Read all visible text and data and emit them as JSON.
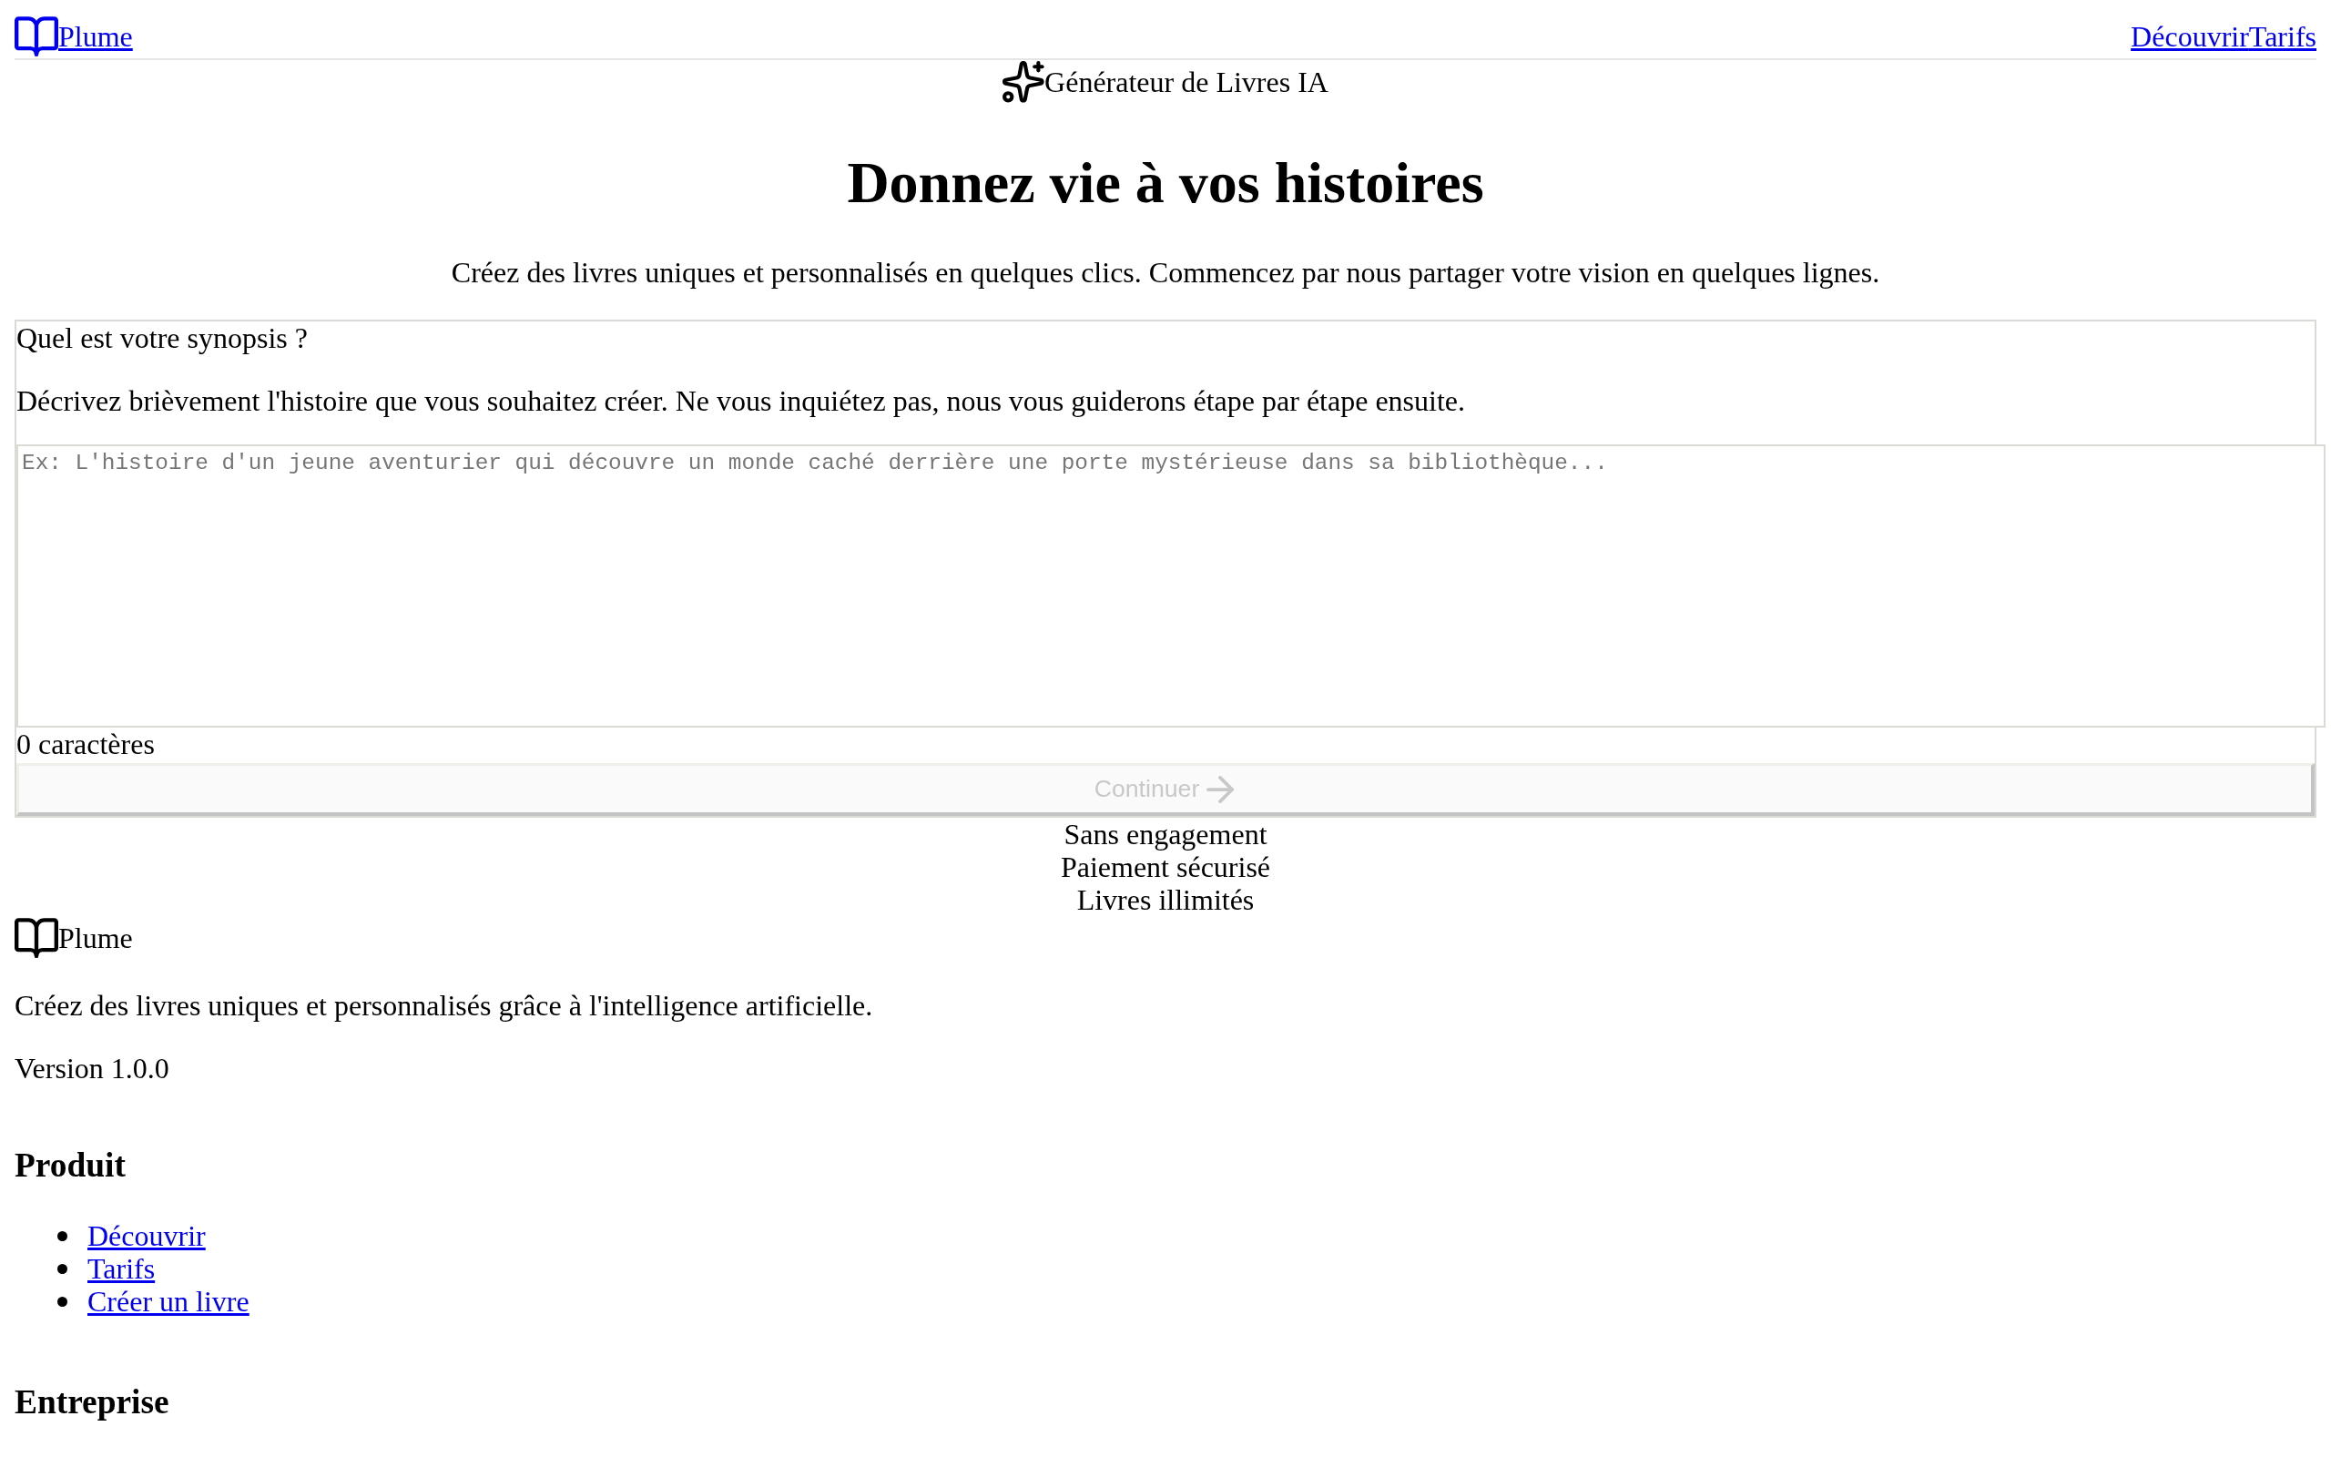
{
  "header": {
    "logo": {
      "label": "Plume"
    },
    "nav": [
      {
        "label": "Découvrir"
      },
      {
        "label": "Tarifs"
      }
    ]
  },
  "badge": {
    "label": "Générateur de Livres IA"
  },
  "hero": {
    "title": "Donnez vie à vos histoires",
    "subtitle": "Créez des livres uniques et personnalisés en quelques clics. Commencez par nous partager votre vision en quelques lignes."
  },
  "form": {
    "label": "Quel est votre synopsis ?",
    "description": "Décrivez brièvement l'histoire que vous souhaitez créer. Ne vous inquiétez pas, nous vous guiderons étape par étape ensuite.",
    "synopsis": {
      "placeholder": "Ex: L'histoire d'un jeune aventurier qui découvre un monde caché derrière une porte mystérieuse dans sa bibliothèque..."
    },
    "char_count": "0 caractères",
    "submit": {
      "label": "Continuer",
      "disabled": true
    }
  },
  "perks": [
    "Sans engagement",
    "Paiement sécurisé",
    "Livres illimités"
  ],
  "footer": {
    "brand": "Plume",
    "tagline": "Créez des livres uniques et personnalisés grâce à l'intelligence artificielle.",
    "version": "Version 1.0.0",
    "sections": [
      {
        "title": "Produit",
        "links": [
          "Découvrir",
          "Tarifs",
          "Créer un livre"
        ]
      },
      {
        "title": "Entreprise"
      }
    ]
  }
}
